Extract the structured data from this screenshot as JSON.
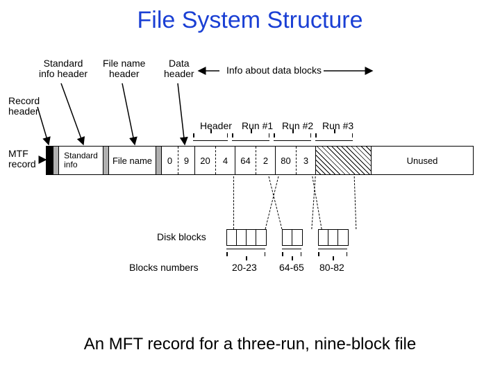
{
  "title": "File System Structure",
  "caption": "An MFT record for a three-run, nine-block file",
  "top_labels": {
    "standard_info_header": "Standard\ninfo header",
    "file_name_header": "File name\nheader",
    "data_header": "Data\nheader",
    "info_about_data_blocks": "Info about data blocks"
  },
  "left_labels": {
    "record_header": "Record\nheader",
    "mtf_record": "MTF\nrecord"
  },
  "brace_labels": {
    "header": "Header",
    "run1": "Run #1",
    "run2": "Run #2",
    "run3": "Run #3"
  },
  "bar_segments": {
    "standard_info": "Standard\ninfo",
    "file_name": "File name",
    "run_pairs": [
      {
        "start": "0",
        "len": "9"
      },
      {
        "start": "20",
        "len": "4"
      },
      {
        "start": "64",
        "len": "2"
      },
      {
        "start": "80",
        "len": "3"
      }
    ],
    "unused": "Unused"
  },
  "bottom": {
    "disk_blocks_label": "Disk blocks",
    "blocks_numbers_label": "Blocks numbers",
    "ranges": [
      "20-23",
      "64-65",
      "80-82"
    ],
    "block_counts": [
      4,
      2,
      3
    ]
  }
}
